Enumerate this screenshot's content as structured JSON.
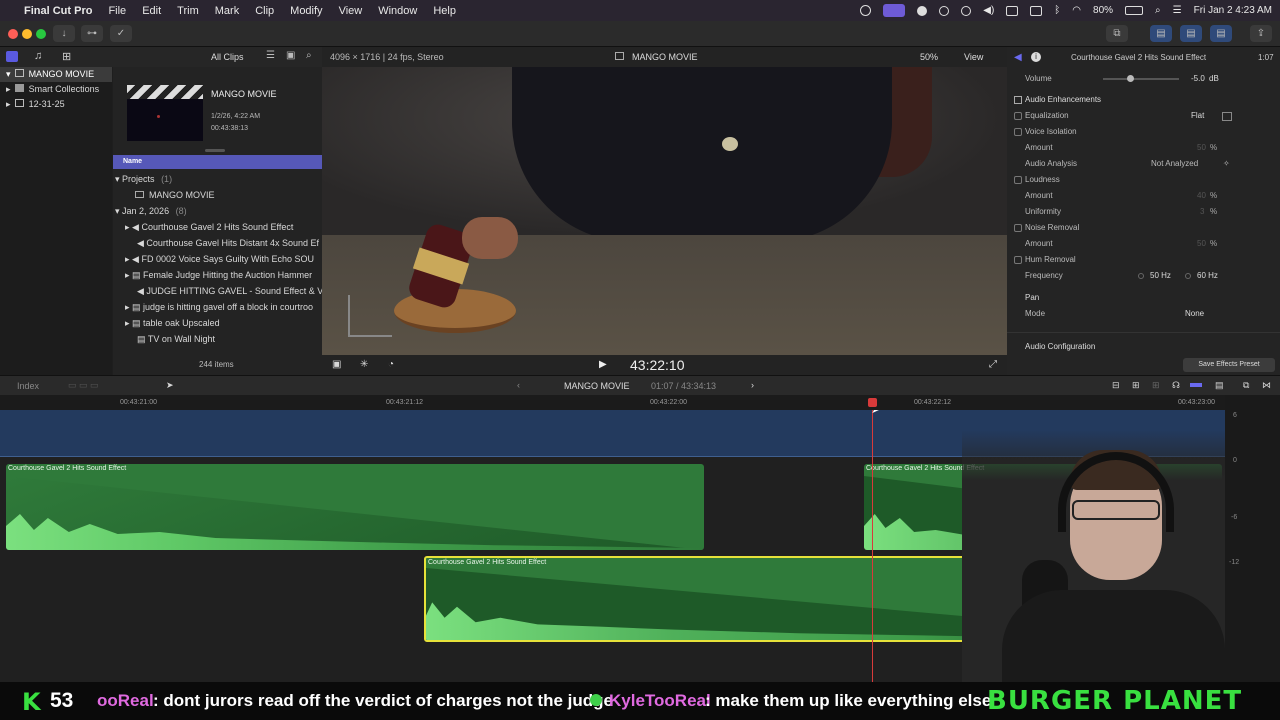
{
  "menubar": {
    "app_name": "Final Cut Pro",
    "items": [
      "File",
      "Edit",
      "Trim",
      "Mark",
      "Clip",
      "Modify",
      "View",
      "Window",
      "Help"
    ],
    "battery": "80%",
    "datetime": "Fri Jan 2  4:23 AM"
  },
  "library": {
    "filter": "All Clips",
    "tree": [
      {
        "label": "MANGO MOVIE"
      },
      {
        "label": "Smart Collections"
      },
      {
        "label": "12-31-25"
      }
    ],
    "event": {
      "title": "MANGO MOVIE",
      "date": "1/2/26, 4:22 AM",
      "duration": "00:43:38:13"
    },
    "column_header": "Name",
    "groups": [
      {
        "label": "Projects",
        "count": "(1)"
      },
      {
        "label": "Jan 2, 2026",
        "count": "(8)"
      }
    ],
    "items": [
      "MANGO MOVIE",
      "Courthouse Gavel 2 Hits Sound Effect",
      "Courthouse Gavel Hits Distant 4x Sound Ef",
      "FD 0002   Voice Says Guilty With Echo SOU",
      "Female Judge Hitting the Auction Hammer",
      "JUDGE HITTING GAVEL - Sound Effect & V",
      "judge is hitting gavel off a block in courtroo",
      "table oak Upscaled",
      "TV on Wall Night"
    ],
    "item_count": "244 items"
  },
  "viewer": {
    "format": "4096 × 1716 | 24 fps, Stereo",
    "project": "MANGO MOVIE",
    "zoom": "50%",
    "view_label": "View",
    "timecode": "43:22:10"
  },
  "inspector": {
    "clip_name": "Courthouse Gavel 2 Hits Sound Effect",
    "duration": "1:07",
    "volume_label": "Volume",
    "volume_value": "-5.0",
    "volume_unit": "dB",
    "section": "Audio Enhancements",
    "rows": [
      {
        "label": "Equalization",
        "value": "Flat"
      },
      {
        "label": "Voice Isolation",
        "value": ""
      },
      {
        "label": "Amount",
        "value": "50",
        "unit": "%"
      },
      {
        "label": "Audio Analysis",
        "value": "Not Analyzed"
      },
      {
        "label": "Loudness",
        "value": ""
      },
      {
        "label": "Amount",
        "value": "40",
        "unit": "%"
      },
      {
        "label": "Uniformity",
        "value": "3",
        "unit": "%"
      },
      {
        "label": "Noise Removal",
        "value": ""
      },
      {
        "label": "Amount",
        "value": "50",
        "unit": "%"
      },
      {
        "label": "Hum Removal",
        "value": ""
      },
      {
        "label": "Frequency",
        "value": "50 Hz",
        "value2": "60 Hz"
      }
    ],
    "pan_label": "Pan",
    "mode_label": "Mode",
    "mode_value": "None",
    "audio_config": "Audio Configuration",
    "save_preset": "Save Effects Preset"
  },
  "timeline": {
    "index_label": "Index",
    "project": "MANGO MOVIE",
    "position": "01:07 / 43:34:13",
    "ruler": [
      "00:43:21:00",
      "00:43:21:12",
      "00:43:22:00",
      "00:43:22:12",
      "00:43:23:00"
    ],
    "clips": [
      {
        "label": "Courthouse Gavel 2 Hits Sound Effect"
      },
      {
        "label": "Courthouse Gavel 2 Hits Sound Effect"
      },
      {
        "label": "Courthouse Gavel 2 Hits Sound Effect"
      }
    ],
    "meter_ticks": [
      "6",
      "0",
      "-6",
      "-12"
    ]
  },
  "stream_chat": {
    "count": "53",
    "msg1_user": "ooReal",
    "msg1_text": ": dont jurors read off the verdict of charges not the judge",
    "msg2_user": "KyleTooReal",
    "msg2_text": ": make them up like everything else",
    "sponsor": "BURGER PLANET"
  }
}
